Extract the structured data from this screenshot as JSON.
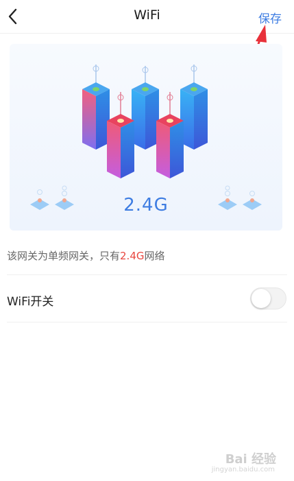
{
  "nav": {
    "title": "WiFi",
    "save_label": "保存"
  },
  "card": {
    "band": "2.4G"
  },
  "note": {
    "prefix": "该网关为单频网关，只有",
    "highlight": "2.4G",
    "suffix": "网络"
  },
  "wifi_switch": {
    "label": "WiFi开关",
    "enabled": false
  },
  "watermark": {
    "brand": "Bai 经验",
    "url": "jingyan.baidu.com"
  },
  "colors": {
    "accent": "#3e7de2",
    "highlight": "#e8463f",
    "arrow": "#e8313a"
  },
  "icons": [
    "back-chevron-icon",
    "wifi-towers-illustration",
    "annotation-arrow"
  ]
}
